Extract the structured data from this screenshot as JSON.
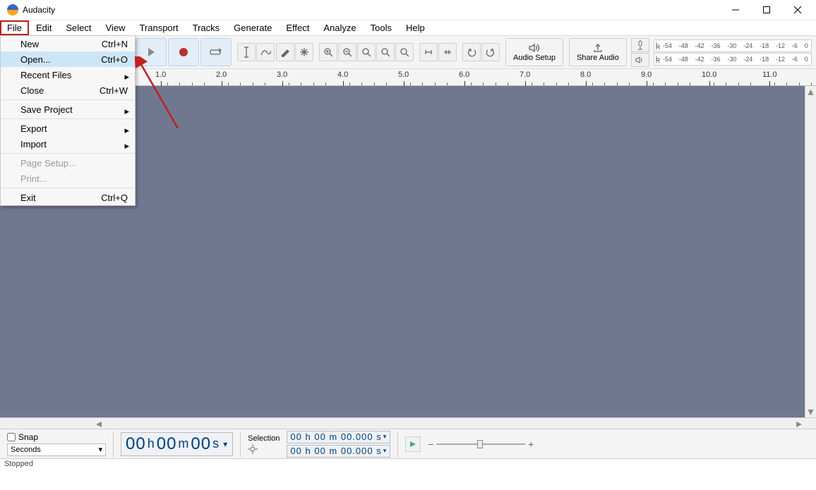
{
  "app": {
    "title": "Audacity"
  },
  "menubar": [
    "File",
    "Edit",
    "Select",
    "View",
    "Transport",
    "Tracks",
    "Generate",
    "Effect",
    "Analyze",
    "Tools",
    "Help"
  ],
  "file_menu": {
    "items": [
      {
        "label": "New",
        "shortcut": "Ctrl+N",
        "type": "item"
      },
      {
        "label": "Open...",
        "shortcut": "Ctrl+O",
        "type": "item",
        "highlight": true
      },
      {
        "label": "Recent Files",
        "shortcut": "",
        "type": "submenu"
      },
      {
        "label": "Close",
        "shortcut": "Ctrl+W",
        "type": "item"
      },
      {
        "type": "sep"
      },
      {
        "label": "Save Project",
        "shortcut": "",
        "type": "submenu"
      },
      {
        "type": "sep"
      },
      {
        "label": "Export",
        "shortcut": "",
        "type": "submenu"
      },
      {
        "label": "Import",
        "shortcut": "",
        "type": "submenu"
      },
      {
        "type": "sep"
      },
      {
        "label": "Page Setup...",
        "shortcut": "",
        "type": "item",
        "disabled": true
      },
      {
        "label": "Print...",
        "shortcut": "",
        "type": "item",
        "disabled": true
      },
      {
        "type": "sep"
      },
      {
        "label": "Exit",
        "shortcut": "Ctrl+Q",
        "type": "item"
      }
    ]
  },
  "toolbar": {
    "audio_setup": "Audio Setup",
    "share_audio": "Share Audio"
  },
  "meter_ticks": [
    "-54",
    "-48",
    "-42",
    "-36",
    "-30",
    "-24",
    "-18",
    "-12",
    "-6",
    "0"
  ],
  "meter_channels": [
    "L",
    "R"
  ],
  "timeline_marks": [
    "1.0",
    "2.0",
    "3.0",
    "4.0",
    "5.0",
    "6.0",
    "7.0",
    "8.0",
    "9.0",
    "10.0",
    "11.0"
  ],
  "bottom": {
    "snap_label": "Snap",
    "snap_unit": "Seconds",
    "time_main": {
      "h": "00",
      "m": "00",
      "s": "00"
    },
    "selection_label": "Selection",
    "sel_start": "00 h 00 m 00.000 s",
    "sel_end": "00 h 00 m 00.000 s"
  },
  "status": "Stopped"
}
